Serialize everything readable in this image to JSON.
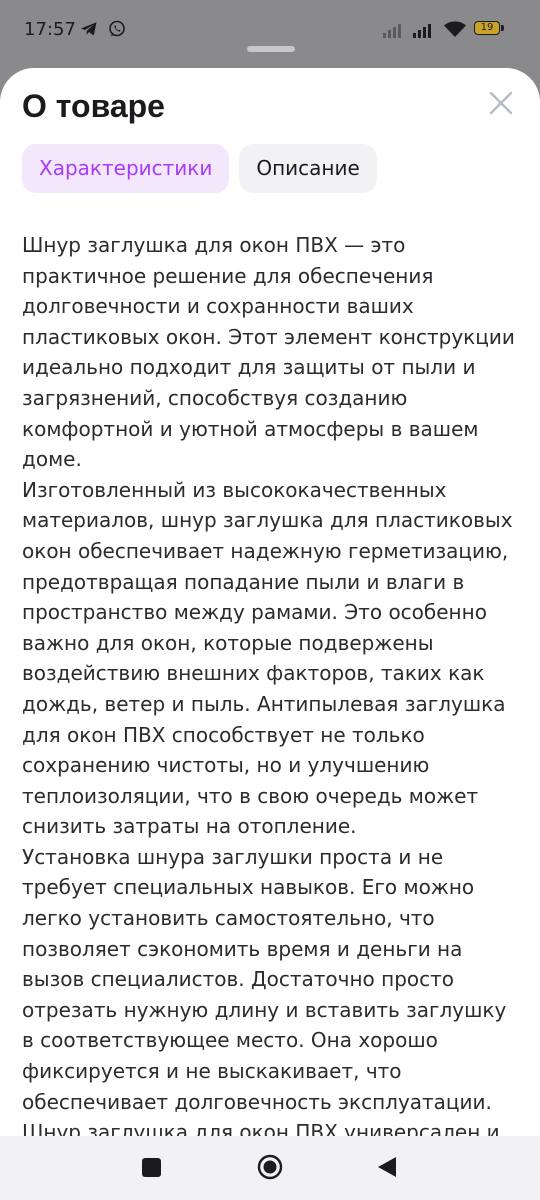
{
  "status_bar": {
    "time": "17:57",
    "battery": "19",
    "icons": [
      "telegram-icon",
      "whatsapp-icon",
      "signal-icon",
      "signal-icon",
      "wifi-icon",
      "battery-icon"
    ]
  },
  "sheet": {
    "title": "О товаре",
    "close_icon": "close-icon",
    "tabs": [
      {
        "label": "Характеристики",
        "active": true
      },
      {
        "label": "Описание",
        "active": false
      }
    ],
    "description": "Шнур заглушка для окон ПВХ — это практичное решение для обеспечения долговечности и сохранности ваших пластиковых окон. Этот элемент конструкции идеально подходит для защиты от пыли и загрязнений, способствуя созданию комфортной и уютной атмосферы в вашем доме.\nИзготовленный из высококачественных материалов, шнур заглушка для пластиковых окон обеспечивает надежную герметизацию, предотвращая попадание пыли и влаги в пространство между рамами. Это особенно важно для окон, которые подвержены воздействию внешних факторов, таких как дождь, ветер и пыль. Антипылевая заглушка для окон ПВХ способствует не только сохранению чистоты, но и улучшению теплоизоляции, что в свою очередь может снизить затраты на отопление.\nУстановка шнура заглушки проста и не требует специальных навыков. Его можно легко установить самостоятельно, что позволяет сэкономить время и деньги на вызов специалистов. Достаточно просто отрезать нужную длину и вставить заглушку в соответствующее место. Она хорошо фиксируется и не выскакивает, что обеспечивает долговечность эксплуатации.\nШнур заглушка для окон ПВХ универсален и"
  },
  "colors": {
    "accent": "#a73afd",
    "accent_bg": "#f3e7fb",
    "text": "#2b2b30",
    "scrim": "#8a8a8d"
  },
  "nav_bar": {
    "icons": [
      "recents-icon",
      "home-icon",
      "back-icon"
    ]
  }
}
